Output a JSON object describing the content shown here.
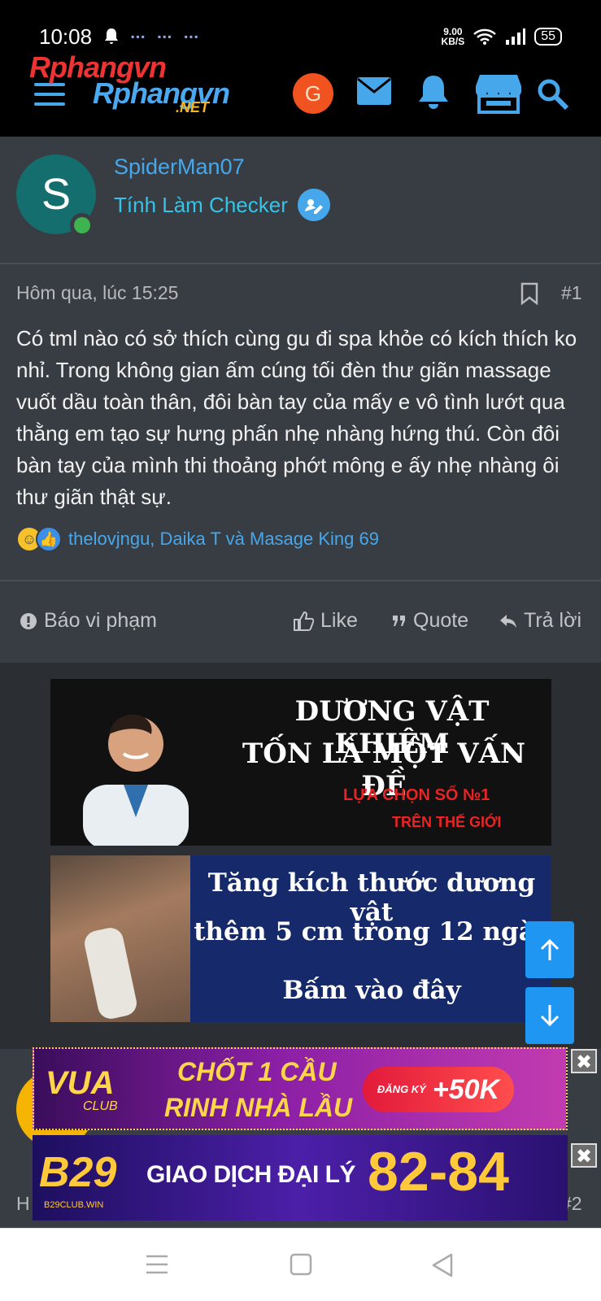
{
  "status_bar": {
    "time": "10:08",
    "speed_value": "9.00",
    "speed_unit": "KB/S",
    "battery": "55"
  },
  "header": {
    "logo_line1": "Rphangvn",
    "logo_line2": "Rphangvn",
    "logo_suffix": ".NET",
    "account_initial": "G",
    "icons": [
      "menu-icon",
      "envelope-icon",
      "bell-icon",
      "store-icon",
      "search-icon"
    ]
  },
  "author": {
    "initial": "S",
    "name": "SpiderMan07",
    "title": "Tính Làm Checker"
  },
  "post": {
    "timestamp": "Hôm qua, lúc 15:25",
    "number": "#1",
    "body": "Có tml nào có sở thích cùng gu đi spa khỏe có kích thích ko nhỉ. Trong không gian ấm cúng tối đèn thư giãn massage vuốt dầu toàn thân, đôi bàn tay của mấy e vô tình lướt qua thằng em tạo sự hưng phấn nhẹ nhàng hứng thú. Còn đôi bàn tay của mình thi thoảng phớt mông e ấy nhẹ nhàng ôi thư giãn thật sự.",
    "reacted_by": "thelovjngu, Daika T và Masage King 69"
  },
  "actions": {
    "report": "Báo vi phạm",
    "like": "Like",
    "quote": "Quote",
    "reply": "Trả lời"
  },
  "ads": {
    "ad1_line1": "DƯƠNG VẬT KHIÊM",
    "ad1_line2": "TỐN LÀ MỘT VẤN ĐỀ",
    "ad1_line3": "LỰA CHỌN SỐ №1",
    "ad1_line4": "TRÊN THẾ GIỚI",
    "ad2_line1": "Tăng kích thước dương vật",
    "ad2_line2": "thêm 5 cm trong 12 ngày",
    "ad2_line3": "Bấm vào đây"
  },
  "next_post": {
    "timestamp_partial": "H",
    "number_partial": "#2"
  },
  "banners": {
    "b1_logo": "VUA",
    "b1_club": "CLUB",
    "b1_line1": "CHỐT 1 CẦU",
    "b1_line2": "RINH NHÀ LẦU",
    "b1_pill_small": "ĐĂNG KÝ",
    "b1_pill_amount": "+50K",
    "b2_logo": "B29",
    "b2_sub": "B29CLUB.WIN",
    "b2_line1": "GIAO DỊCH ĐẠI LÝ",
    "b2_rate": "82-84",
    "close": "✖"
  },
  "colors": {
    "accent": "#47a7eb",
    "background": "#2b2f33",
    "panel": "#383d43",
    "scroll_button": "#2096f3"
  }
}
